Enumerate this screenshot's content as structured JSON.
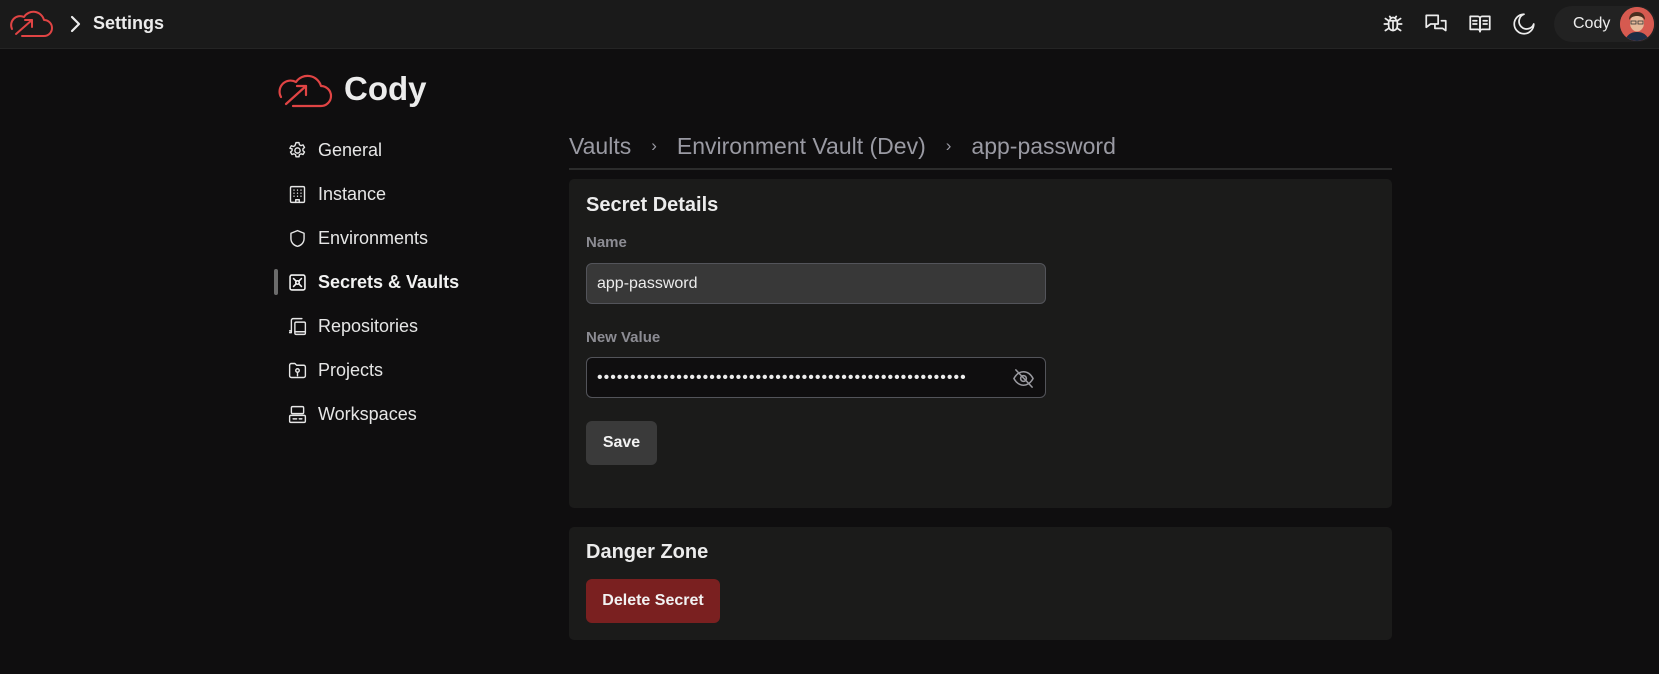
{
  "topbar": {
    "title": "Settings",
    "icons": [
      "bug-icon",
      "chat-icon",
      "docs-book-icon",
      "dark-mode-moon-icon"
    ],
    "user": {
      "name": "Cody"
    }
  },
  "brand": {
    "name": "Cody",
    "accent_color": "#e04444"
  },
  "sidebar": {
    "items": [
      {
        "label": "General",
        "icon": "gear-icon",
        "active": false
      },
      {
        "label": "Instance",
        "icon": "building-icon",
        "active": false
      },
      {
        "label": "Environments",
        "icon": "shield-icon",
        "active": false
      },
      {
        "label": "Secrets & Vaults",
        "icon": "vault-icon",
        "active": true
      },
      {
        "label": "Repositories",
        "icon": "repositories-icon",
        "active": false
      },
      {
        "label": "Projects",
        "icon": "folder-key-icon",
        "active": false
      },
      {
        "label": "Workspaces",
        "icon": "workspaces-icon",
        "active": false
      }
    ]
  },
  "breadcrumb": {
    "items": [
      "Vaults",
      "Environment Vault (Dev)",
      "app-password"
    ],
    "separator": "›"
  },
  "secret_details": {
    "title": "Secret Details",
    "name_label": "Name",
    "name_value": "app-password",
    "value_label": "New Value",
    "value_masked": "••••••••••••••••••••••••••••••••••••••••••••••••••••••••",
    "save_label": "Save"
  },
  "danger_zone": {
    "title": "Danger Zone",
    "delete_label": "Delete Secret",
    "delete_color": "#7a2020"
  }
}
